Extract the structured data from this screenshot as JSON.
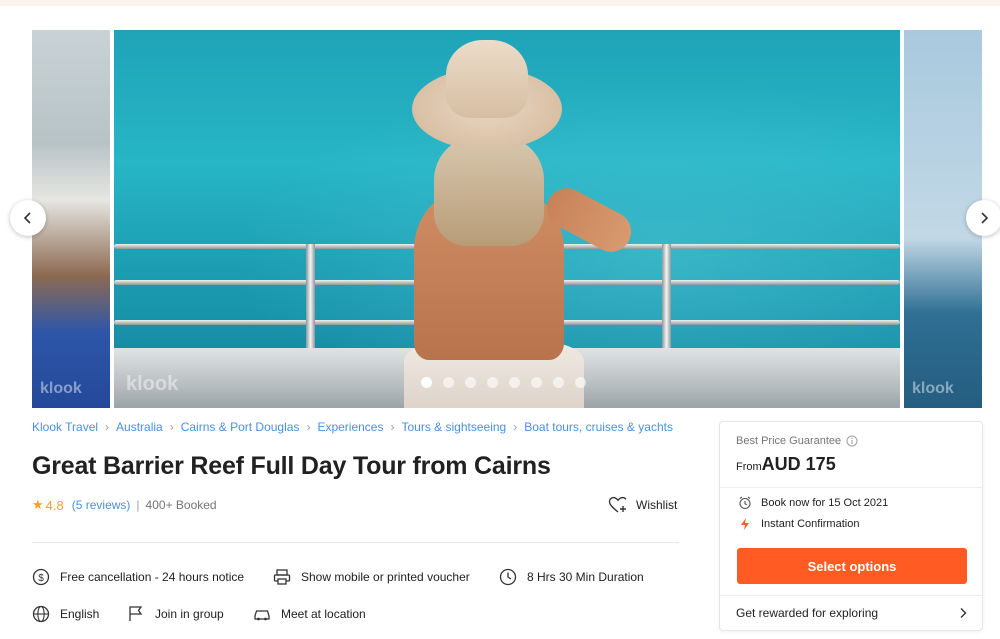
{
  "gallery": {
    "watermark": "klook",
    "slide_count": 8,
    "active_slide": 1
  },
  "breadcrumb": [
    "Klook Travel",
    "Australia",
    "Cairns & Port Douglas",
    "Experiences",
    "Tours & sightseeing",
    "Boat tours, cruises & yachts"
  ],
  "activity": {
    "title": "Great Barrier Reef Full Day Tour from Cairns",
    "rating": "4.8",
    "reviews": "(5 reviews)",
    "separator": "|",
    "booked": "400+ Booked",
    "wishlist_label": "Wishlist"
  },
  "features": {
    "cancellation": "Free cancellation - 24 hours notice",
    "voucher": "Show mobile or printed voucher",
    "duration": "8 Hrs 30 Min Duration",
    "language": "English",
    "group": "Join in group",
    "meeting": "Meet at location"
  },
  "booking": {
    "guarantee": "Best Price Guarantee",
    "from_label": "From",
    "price": "AUD 175",
    "book_now": "Book now for 15 Oct 2021",
    "instant": "Instant Confirmation",
    "select_label": "Select options",
    "reward_label": "Get rewarded for exploring"
  },
  "colors": {
    "accent": "#ff5b22",
    "link": "#4a90e2",
    "star": "#ff9d26"
  }
}
